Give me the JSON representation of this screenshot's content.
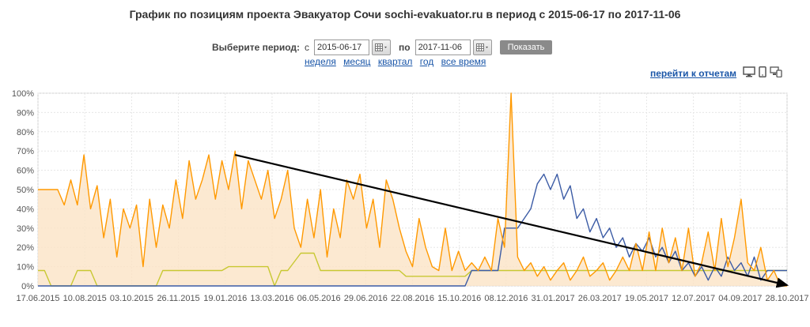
{
  "header": {
    "title": "График по позициям проекта Эвакуатор Сочи sochi-evakuator.ru в период с 2015-06-17 по 2017-11-06"
  },
  "period": {
    "label": "Выберите период:",
    "from_prefix": "с",
    "from_value": "2015-06-17",
    "to_prefix": "по",
    "to_value": "2017-11-06",
    "show_label": "Показать"
  },
  "quick_links": [
    "неделя",
    "месяц",
    "квартал",
    "год",
    "все время"
  ],
  "reports_link": "перейти к отчетам",
  "icons": [
    "calendar-icon",
    "desktop-icon",
    "mobile-icon",
    "multi-device-icon"
  ],
  "colors": {
    "orange": "#ff9900",
    "orange_fill": "#fbe3c6",
    "blue": "#3b5ba5",
    "yellow": "#c8c832",
    "trend": "#000000"
  },
  "chart_data": {
    "type": "line",
    "title": "",
    "xlabel": "",
    "ylabel": "",
    "ylim": [
      0,
      100
    ],
    "grid": true,
    "x_tick_labels": [
      "17.06.2015",
      "10.08.2015",
      "03.10.2015",
      "26.11.2015",
      "19.01.2016",
      "13.03.2016",
      "06.05.2016",
      "29.06.2016",
      "22.08.2016",
      "15.10.2016",
      "08.12.2016",
      "31.01.2017",
      "26.03.2017",
      "19.05.2017",
      "12.07.2017",
      "04.09.2017",
      "28.10.2017"
    ],
    "y_tick_labels": [
      "0%",
      "10%",
      "20%",
      "30%",
      "40%",
      "50%",
      "60%",
      "70%",
      "80%",
      "90%",
      "100%"
    ],
    "series": [
      {
        "color": "#ff9900",
        "fill": "#fbe3c6",
        "points": [
          [
            0,
            50
          ],
          [
            3,
            50
          ],
          [
            4,
            42
          ],
          [
            5,
            55
          ],
          [
            6,
            42
          ],
          [
            7,
            68
          ],
          [
            8,
            40
          ],
          [
            9,
            52
          ],
          [
            10,
            25
          ],
          [
            11,
            45
          ],
          [
            12,
            15
          ],
          [
            13,
            40
          ],
          [
            14,
            30
          ],
          [
            15,
            42
          ],
          [
            16,
            10
          ],
          [
            17,
            45
          ],
          [
            18,
            20
          ],
          [
            19,
            42
          ],
          [
            20,
            30
          ],
          [
            21,
            55
          ],
          [
            22,
            35
          ],
          [
            23,
            65
          ],
          [
            24,
            45
          ],
          [
            25,
            55
          ],
          [
            26,
            68
          ],
          [
            27,
            45
          ],
          [
            28,
            65
          ],
          [
            29,
            50
          ],
          [
            30,
            70
          ],
          [
            31,
            40
          ],
          [
            32,
            65
          ],
          [
            33,
            55
          ],
          [
            34,
            45
          ],
          [
            35,
            60
          ],
          [
            36,
            35
          ],
          [
            37,
            45
          ],
          [
            38,
            60
          ],
          [
            39,
            30
          ],
          [
            40,
            20
          ],
          [
            41,
            45
          ],
          [
            42,
            25
          ],
          [
            43,
            50
          ],
          [
            44,
            15
          ],
          [
            45,
            40
          ],
          [
            46,
            25
          ],
          [
            47,
            55
          ],
          [
            48,
            45
          ],
          [
            49,
            58
          ],
          [
            50,
            30
          ],
          [
            51,
            45
          ],
          [
            52,
            20
          ],
          [
            53,
            55
          ],
          [
            54,
            45
          ],
          [
            55,
            30
          ],
          [
            56,
            18
          ],
          [
            57,
            10
          ],
          [
            58,
            35
          ],
          [
            59,
            20
          ],
          [
            60,
            10
          ],
          [
            61,
            8
          ],
          [
            62,
            30
          ],
          [
            63,
            8
          ],
          [
            64,
            18
          ],
          [
            65,
            8
          ],
          [
            66,
            12
          ],
          [
            67,
            8
          ],
          [
            68,
            15
          ],
          [
            69,
            8
          ],
          [
            70,
            35
          ],
          [
            71,
            20
          ],
          [
            72,
            100
          ],
          [
            73,
            15
          ],
          [
            74,
            8
          ],
          [
            75,
            12
          ],
          [
            76,
            5
          ],
          [
            77,
            10
          ],
          [
            78,
            3
          ],
          [
            79,
            8
          ],
          [
            80,
            12
          ],
          [
            81,
            3
          ],
          [
            82,
            8
          ],
          [
            83,
            15
          ],
          [
            84,
            5
          ],
          [
            85,
            8
          ],
          [
            86,
            12
          ],
          [
            87,
            3
          ],
          [
            88,
            8
          ],
          [
            89,
            15
          ],
          [
            90,
            8
          ],
          [
            91,
            22
          ],
          [
            92,
            8
          ],
          [
            93,
            28
          ],
          [
            94,
            8
          ],
          [
            95,
            30
          ],
          [
            96,
            12
          ],
          [
            97,
            25
          ],
          [
            98,
            8
          ],
          [
            99,
            30
          ],
          [
            100,
            5
          ],
          [
            101,
            12
          ],
          [
            102,
            28
          ],
          [
            103,
            8
          ],
          [
            104,
            35
          ],
          [
            105,
            10
          ],
          [
            106,
            25
          ],
          [
            107,
            45
          ],
          [
            108,
            12
          ],
          [
            109,
            8
          ],
          [
            110,
            20
          ],
          [
            111,
            3
          ],
          [
            112,
            8
          ],
          [
            113,
            0
          ],
          [
            114,
            0
          ]
        ]
      },
      {
        "color": "#3b5ba5",
        "fill": "",
        "points": [
          [
            0,
            0
          ],
          [
            40,
            0
          ],
          [
            55,
            0
          ],
          [
            65,
            0
          ],
          [
            66,
            8
          ],
          [
            70,
            8
          ],
          [
            71,
            30
          ],
          [
            73,
            30
          ],
          [
            74,
            35
          ],
          [
            75,
            40
          ],
          [
            76,
            53
          ],
          [
            77,
            58
          ],
          [
            78,
            50
          ],
          [
            79,
            58
          ],
          [
            80,
            45
          ],
          [
            81,
            52
          ],
          [
            82,
            35
          ],
          [
            83,
            40
          ],
          [
            84,
            28
          ],
          [
            85,
            35
          ],
          [
            86,
            25
          ],
          [
            87,
            30
          ],
          [
            88,
            20
          ],
          [
            89,
            25
          ],
          [
            90,
            15
          ],
          [
            91,
            22
          ],
          [
            92,
            18
          ],
          [
            93,
            25
          ],
          [
            94,
            15
          ],
          [
            95,
            20
          ],
          [
            96,
            12
          ],
          [
            97,
            18
          ],
          [
            98,
            8
          ],
          [
            99,
            12
          ],
          [
            100,
            5
          ],
          [
            101,
            10
          ],
          [
            102,
            3
          ],
          [
            103,
            10
          ],
          [
            104,
            5
          ],
          [
            105,
            15
          ],
          [
            106,
            8
          ],
          [
            107,
            12
          ],
          [
            108,
            5
          ],
          [
            109,
            15
          ],
          [
            110,
            3
          ],
          [
            111,
            8
          ],
          [
            112,
            8
          ],
          [
            113,
            8
          ],
          [
            114,
            8
          ]
        ]
      },
      {
        "color": "#c8c832",
        "fill": "",
        "points": [
          [
            0,
            8
          ],
          [
            1,
            8
          ],
          [
            2,
            0
          ],
          [
            5,
            0
          ],
          [
            6,
            8
          ],
          [
            8,
            8
          ],
          [
            9,
            0
          ],
          [
            18,
            0
          ],
          [
            19,
            8
          ],
          [
            28,
            8
          ],
          [
            29,
            10
          ],
          [
            35,
            10
          ],
          [
            36,
            0
          ],
          [
            37,
            8
          ],
          [
            38,
            8
          ],
          [
            40,
            17
          ],
          [
            42,
            17
          ],
          [
            43,
            8
          ],
          [
            55,
            8
          ],
          [
            56,
            5
          ],
          [
            65,
            5
          ],
          [
            66,
            8
          ],
          [
            113,
            8
          ],
          [
            114,
            8
          ]
        ]
      }
    ],
    "trend": {
      "color": "#000000",
      "from": [
        30,
        68
      ],
      "to": [
        114,
        0
      ]
    },
    "x_max": 114
  }
}
